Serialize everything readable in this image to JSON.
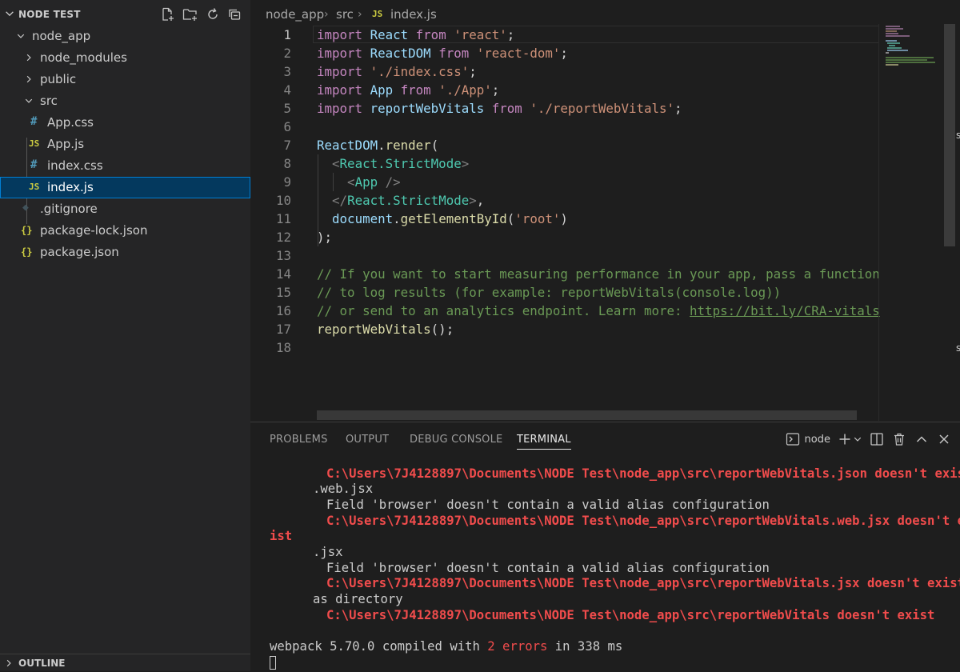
{
  "explorer": {
    "title": "NODE TEST",
    "actions": [
      "new-file-icon",
      "new-folder-icon",
      "refresh-icon",
      "collapse-all-icon"
    ],
    "items": [
      {
        "label": "node_app",
        "kind": "folder-open",
        "depth": 0
      },
      {
        "label": "node_modules",
        "kind": "folder-closed",
        "depth": 1
      },
      {
        "label": "public",
        "kind": "folder-closed",
        "depth": 1
      },
      {
        "label": "src",
        "kind": "folder-open",
        "depth": 1
      },
      {
        "label": "App.css",
        "kind": "css",
        "icon": "#",
        "depth": 2
      },
      {
        "label": "App.js",
        "kind": "js",
        "icon": "JS",
        "depth": 2
      },
      {
        "label": "index.css",
        "kind": "css",
        "icon": "#",
        "depth": 2
      },
      {
        "label": "index.js",
        "kind": "js",
        "icon": "JS",
        "depth": 2,
        "selected": true
      },
      {
        "label": ".gitignore",
        "kind": "git",
        "icon": "◆",
        "depth": 1
      },
      {
        "label": "package-lock.json",
        "kind": "json",
        "icon": "{}",
        "depth": 1
      },
      {
        "label": "package.json",
        "kind": "json",
        "icon": "{}",
        "depth": 1
      }
    ],
    "outline_title": "OUTLINE"
  },
  "breadcrumb": {
    "parts": [
      "node_app",
      "src"
    ],
    "file_icon": "JS",
    "file": "index.js"
  },
  "editor": {
    "active_line": 1,
    "lines": [
      {
        "n": "1",
        "tokens": [
          [
            "k",
            "import "
          ],
          [
            "v",
            "React "
          ],
          [
            "k",
            "from "
          ],
          [
            "s",
            "'react'"
          ],
          [
            "p",
            ";"
          ]
        ]
      },
      {
        "n": "2",
        "tokens": [
          [
            "k",
            "import "
          ],
          [
            "v",
            "ReactDOM "
          ],
          [
            "k",
            "from "
          ],
          [
            "s",
            "'react-dom'"
          ],
          [
            "p",
            ";"
          ]
        ]
      },
      {
        "n": "3",
        "tokens": [
          [
            "k",
            "import "
          ],
          [
            "s",
            "'./index.css'"
          ],
          [
            "p",
            ";"
          ]
        ]
      },
      {
        "n": "4",
        "tokens": [
          [
            "k",
            "import "
          ],
          [
            "v",
            "App "
          ],
          [
            "k",
            "from "
          ],
          [
            "s",
            "'./App'"
          ],
          [
            "p",
            ";"
          ]
        ]
      },
      {
        "n": "5",
        "tokens": [
          [
            "k",
            "import "
          ],
          [
            "v",
            "reportWebVitals "
          ],
          [
            "k",
            "from "
          ],
          [
            "s",
            "'./reportWebVitals'"
          ],
          [
            "p",
            ";"
          ]
        ]
      },
      {
        "n": "6",
        "tokens": []
      },
      {
        "n": "7",
        "tokens": [
          [
            "v",
            "ReactDOM"
          ],
          [
            "p",
            "."
          ],
          [
            "f",
            "render"
          ],
          [
            "p",
            "("
          ]
        ]
      },
      {
        "n": "8",
        "tokens": [
          [
            "p",
            "  "
          ],
          [
            "tg",
            "<"
          ],
          [
            "t",
            "React.StrictMode"
          ],
          [
            "tg",
            ">"
          ]
        ]
      },
      {
        "n": "9",
        "tokens": [
          [
            "p",
            "    "
          ],
          [
            "tg",
            "<"
          ],
          [
            "t",
            "App "
          ],
          [
            "tg",
            "/>"
          ]
        ]
      },
      {
        "n": "10",
        "tokens": [
          [
            "p",
            "  "
          ],
          [
            "tg",
            "</"
          ],
          [
            "t",
            "React.StrictMode"
          ],
          [
            "tg",
            ">"
          ],
          [
            "p",
            ","
          ]
        ]
      },
      {
        "n": "11",
        "tokens": [
          [
            "p",
            "  "
          ],
          [
            "v",
            "document"
          ],
          [
            "p",
            "."
          ],
          [
            "f",
            "getElementById"
          ],
          [
            "p",
            "("
          ],
          [
            "s",
            "'root'"
          ],
          [
            "p",
            ")"
          ]
        ]
      },
      {
        "n": "12",
        "tokens": [
          [
            "p",
            ");"
          ]
        ]
      },
      {
        "n": "13",
        "tokens": []
      },
      {
        "n": "14",
        "tokens": [
          [
            "c",
            "// If you want to start measuring performance in your app, pass a function"
          ]
        ]
      },
      {
        "n": "15",
        "tokens": [
          [
            "c",
            "// to log results (for example: reportWebVitals(console.log))"
          ]
        ]
      },
      {
        "n": "16",
        "tokens": [
          [
            "c",
            "// or send to an analytics endpoint. Learn more: "
          ],
          [
            "u",
            "https://bit.ly/CRA-vitals"
          ]
        ]
      },
      {
        "n": "17",
        "tokens": [
          [
            "f",
            "reportWebVitals"
          ],
          [
            "p",
            "();"
          ]
        ]
      },
      {
        "n": "18",
        "tokens": []
      }
    ]
  },
  "panel": {
    "tabs": [
      "PROBLEMS",
      "OUTPUT",
      "DEBUG CONSOLE",
      "TERMINAL"
    ],
    "active_tab": "TERMINAL",
    "terminal_name": "node",
    "tool_icons": [
      "terminal-icon",
      "add-icon",
      "chevron-down-icon",
      "split-icon",
      "trash-icon",
      "maximize-icon",
      "close-icon"
    ],
    "terminal_lines": [
      {
        "text": "C:\\Users\\7J4128897\\Documents\\NODE Test\\node_app\\src\\reportWebVitals.json doesn't exist",
        "style": "err",
        "indent": 4
      },
      {
        "text": ".web.jsx",
        "style": "tw",
        "indent": 3
      },
      {
        "text": "Field 'browser' doesn't contain a valid alias configuration",
        "style": "tw",
        "indent": 4
      },
      {
        "text": "C:\\Users\\7J4128897\\Documents\\NODE Test\\node_app\\src\\reportWebVitals.web.jsx doesn't ex",
        "style": "err",
        "indent": 4
      },
      {
        "text": "ist",
        "style": "err",
        "indent": 0
      },
      {
        "text": ".jsx",
        "style": "tw",
        "indent": 3
      },
      {
        "text": "Field 'browser' doesn't contain a valid alias configuration",
        "style": "tw",
        "indent": 4
      },
      {
        "text": "C:\\Users\\7J4128897\\Documents\\NODE Test\\node_app\\src\\reportWebVitals.jsx doesn't exist",
        "style": "err",
        "indent": 4
      },
      {
        "text": "as directory",
        "style": "tw",
        "indent": 3
      },
      {
        "text": "C:\\Users\\7J4128897\\Documents\\NODE Test\\node_app\\src\\reportWebVitals doesn't exist",
        "style": "err",
        "indent": 4
      },
      {
        "text": "",
        "style": "tw",
        "indent": 0
      }
    ],
    "summary": {
      "prefix": "webpack 5.70.0 compiled with ",
      "errors": "2 errors",
      "suffix": " in 338 ms"
    }
  },
  "colors": {
    "keyword": "#c586c0",
    "variable": "#9cdcfe",
    "string": "#ce9178",
    "function": "#dcdcaa",
    "component": "#4ec9b0",
    "comment": "#6a9955",
    "error": "#f14c4c",
    "selection": "#04395e"
  }
}
